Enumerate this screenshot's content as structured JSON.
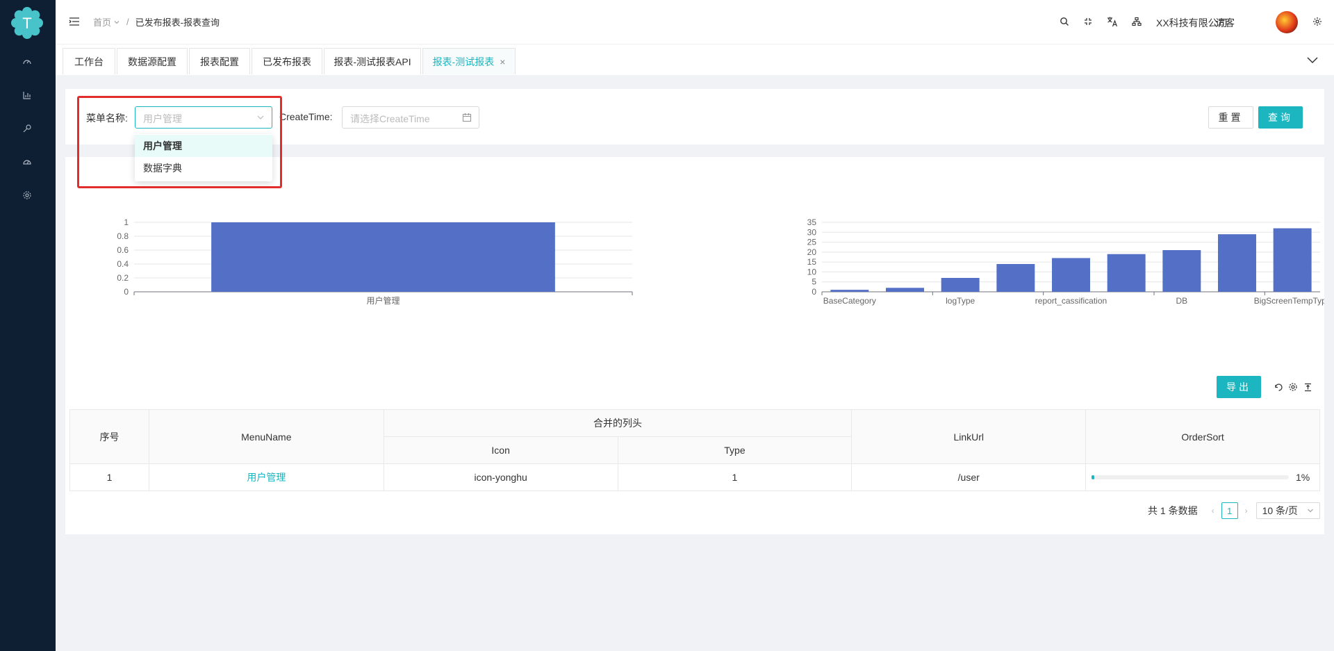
{
  "header": {
    "breadcrumb_home": "首页",
    "breadcrumb_current": "已发布报表-报表查询",
    "company": "XX科技有限公司",
    "visitor": "访客"
  },
  "sidebar": {
    "logo_letter": "T",
    "icons": [
      "dashboard-icon",
      "chart-icon",
      "wrench-icon",
      "gauge-icon",
      "settings-icon"
    ]
  },
  "tabs": [
    {
      "label": "工作台"
    },
    {
      "label": "数据源配置"
    },
    {
      "label": "报表配置"
    },
    {
      "label": "已发布报表"
    },
    {
      "label": "报表-测试报表API"
    },
    {
      "label": "报表-测试报表",
      "close": "×"
    }
  ],
  "filter": {
    "menu_label": "菜单名称:",
    "menu_placeholder": "用户管理",
    "createtime_label": "CreateTime:",
    "createtime_placeholder": "请选择CreateTime",
    "reset": "重置",
    "query": "查询"
  },
  "dropdown": {
    "options": [
      "用户管理",
      "数据字典"
    ],
    "selected": "用户管理"
  },
  "colors": {
    "accent": "#1bb6c0",
    "bar": "#5470c6",
    "sidebar": "#0e1f34",
    "highlight": "#e22d2d"
  },
  "chart_data": [
    {
      "type": "bar",
      "categories": [
        "用户管理"
      ],
      "values": [
        1
      ],
      "ylim": [
        0,
        1
      ],
      "yticks": [
        "0",
        "0.2",
        "0.4",
        "0.6",
        "0.8",
        "1"
      ],
      "grid": true
    },
    {
      "type": "bar",
      "categories": [
        "BaseCategory",
        "",
        "logType",
        "",
        "report_cassification",
        "",
        "DB",
        "",
        "BigScreenTempType"
      ],
      "values": [
        1,
        2,
        7,
        14,
        17,
        19,
        21,
        29,
        32
      ],
      "ylim": [
        0,
        35
      ],
      "yticks": [
        "0",
        "5",
        "10",
        "15",
        "20",
        "25",
        "30",
        "35"
      ],
      "grid": true
    }
  ],
  "table": {
    "export": "导出",
    "headers": {
      "index": "序号",
      "menu_name": "MenuName",
      "merged": "合并的列头",
      "icon": "Icon",
      "type": "Type",
      "link_url": "LinkUrl",
      "order_sort": "OrderSort"
    },
    "rows": [
      {
        "index": "1",
        "menu_name": "用户管理",
        "icon": "icon-yonghu",
        "type": "1",
        "link_url": "/user",
        "order_sort": "1%",
        "progress": 0.01
      }
    ]
  },
  "pager": {
    "total": "共 1 条数据",
    "page": "1",
    "size": "10 条/页"
  }
}
